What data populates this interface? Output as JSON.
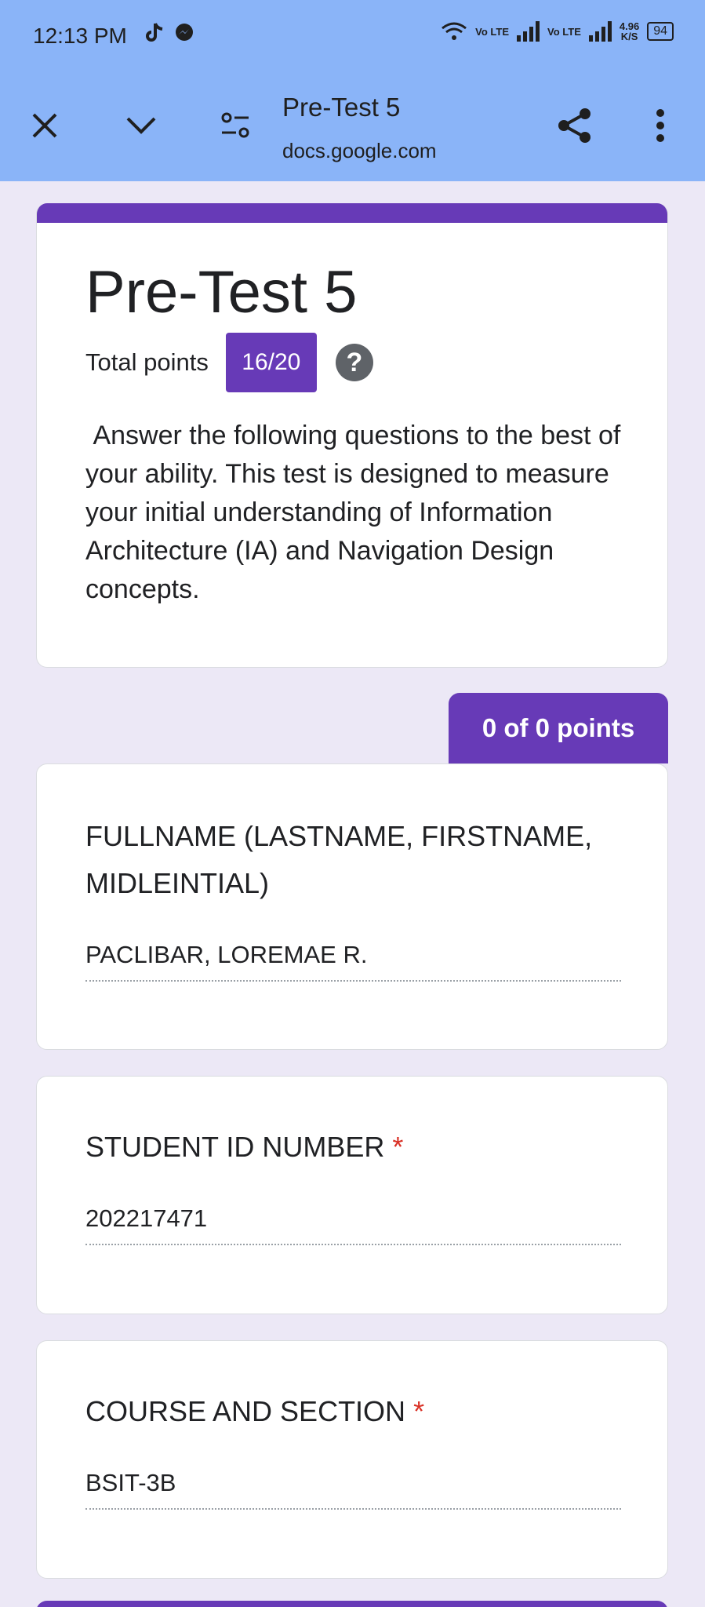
{
  "status_bar": {
    "time": "12:13 PM",
    "network_1": "Vo LTE",
    "network_2": "Vo LTE",
    "speed_value": "4.96",
    "speed_unit": "K/S",
    "battery": "94"
  },
  "browser_bar": {
    "title": "Pre-Test 5",
    "url": "docs.google.com",
    "icons": [
      "close-icon",
      "chevron-down-icon",
      "page-settings-icon",
      "share-icon",
      "more-vert-icon"
    ]
  },
  "form_header": {
    "title": "Pre-Test 5",
    "total_points_label": "Total points",
    "score": "16/20",
    "help_symbol": "?",
    "description": " Answer the following questions to the best of your ability. This test is designed to measure your initial understanding of Information Architecture (IA) and Navigation Design concepts."
  },
  "section": {
    "points": "0 of 0 points"
  },
  "questions": [
    {
      "title": "FULLNAME (LASTNAME, FIRSTNAME, MIDLEINTIAL)",
      "required": "",
      "answer": "PACLIBAR, LOREMAE R."
    },
    {
      "title": "STUDENT ID NUMBER",
      "required": "*",
      "answer": "202217471"
    },
    {
      "title": "COURSE AND SECTION",
      "required": "*",
      "answer": "BSIT-3B"
    }
  ],
  "colors": {
    "accent": "#673ab7",
    "topbar": "#8ab4f8",
    "background": "#ece8f6",
    "required": "#d93025"
  }
}
